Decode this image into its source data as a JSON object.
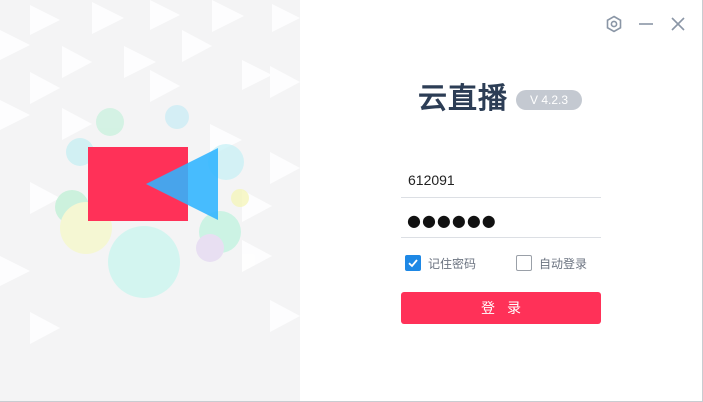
{
  "app": {
    "name": "云直播",
    "version": "V 4.2.3"
  },
  "window_controls": {
    "settings_icon": "hexagon-settings-icon",
    "minimize_icon": "minimize-icon",
    "close_icon": "close-icon"
  },
  "login_form": {
    "account_value": "612091",
    "password_mask": "●●●●●●",
    "remember_password": {
      "label": "记住密码",
      "checked": true
    },
    "auto_login": {
      "label": "自动登录",
      "checked": false
    },
    "submit_label": "登录"
  },
  "colors": {
    "accent": "#ff3158",
    "brand_text": "#2c3d55",
    "checkbox_checked": "#1e88e5",
    "illustration_blue": "#2fb4ff",
    "illustration_red": "#ff3158"
  }
}
